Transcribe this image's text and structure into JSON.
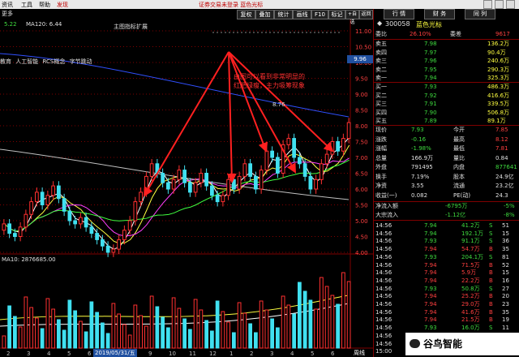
{
  "menubar": {
    "items": [
      "资讯",
      "工具",
      "帮助"
    ],
    "brand": "发现",
    "title": "证券交易未登录  蓝色光标"
  },
  "toolbar": {
    "left_items": [
      "更多"
    ],
    "ma_label": "5.22",
    "ma120": "MA120: 6.44",
    "tabs": [
      "复权",
      "叠加",
      "统计",
      "画线",
      "F10",
      "标记",
      "+自选",
      "返回"
    ]
  },
  "chart": {
    "concept_labels": [
      "教育",
      "人工智能",
      "RCS概念",
      "字节跳动"
    ],
    "price_marker": "9.96",
    "sub_indicator": "MA10: 2876685.00",
    "date_label": "2019/05/31/五",
    "main_label": "主图指标扩展",
    "y_ticks": [
      "11.00",
      "10.50",
      "10.00",
      "9.50",
      "9.00",
      "8.50",
      "8.00",
      "7.50",
      "7.00",
      "6.50",
      "6.00",
      "5.50",
      "5.00",
      "4.50",
      "4.00"
    ],
    "x_ticks": [
      "2",
      "3",
      "4",
      "5",
      "6",
      "7",
      "8",
      "9",
      "10",
      "11",
      "12",
      "1",
      "2",
      "3",
      "4",
      "5",
      "6"
    ],
    "vol_ticks": [
      "×1000"
    ],
    "annotation": "由图可以看到非常明显的\n红肥绿瘦，主力吸筹现象",
    "peak_label": "8.76",
    "bottom_label": "周线"
  },
  "right_panel": {
    "tabs": [
      "行 情",
      "财 务",
      "同 列"
    ],
    "code": "300058",
    "name": "蓝色光标",
    "weibi": {
      "label": "委比",
      "value": "26.10%",
      "label2": "委差",
      "value2": "9617"
    },
    "sell": [
      {
        "label": "卖五",
        "price": "7.98",
        "vol": "136.2万"
      },
      {
        "label": "卖四",
        "price": "7.97",
        "vol": "90.4万"
      },
      {
        "label": "卖三",
        "price": "7.96",
        "vol": "240.6万"
      },
      {
        "label": "卖二",
        "price": "7.95",
        "vol": "290.3万"
      },
      {
        "label": "卖一",
        "price": "7.94",
        "vol": "325.3万"
      }
    ],
    "buy": [
      {
        "label": "买一",
        "price": "7.93",
        "vol": "486.3万"
      },
      {
        "label": "买二",
        "price": "7.92",
        "vol": "416.6万"
      },
      {
        "label": "买三",
        "price": "7.91",
        "vol": "339.5万"
      },
      {
        "label": "买四",
        "price": "7.90",
        "vol": "506.8万"
      },
      {
        "label": "买五",
        "price": "7.89",
        "vol": "89.1万"
      }
    ],
    "stats": [
      {
        "l1": "现价",
        "v1": "7.93",
        "l2": "今开",
        "v2": "7.85"
      },
      {
        "l1": "涨跌",
        "v1": "-0.16",
        "l2": "最高",
        "v2": "8.12"
      },
      {
        "l1": "涨幅",
        "v1": "-1.98%",
        "l2": "最低",
        "v2": "7.81"
      },
      {
        "l1": "总量",
        "v1": "166.9万",
        "l2": "量比",
        "v2": "0.84"
      },
      {
        "l1": "外盘",
        "v1": "791495",
        "l2": "内盘",
        "v2": "877641"
      },
      {
        "l1": "换手",
        "v1": "7.19%",
        "l2": "股本",
        "v2": "24.9亿"
      },
      {
        "l1": "净资",
        "v1": "3.55",
        "l2": "流通",
        "v2": "23.2亿"
      },
      {
        "l1": "收益(一)",
        "v1": "0.082",
        "l2": "PE(动)",
        "v2": "24.3"
      }
    ],
    "flow": [
      {
        "label": "净流入额",
        "value": "-6795万",
        "pct": "-5%"
      },
      {
        "label": "大宗流入",
        "value": "-1.12亿",
        "pct": "-8%"
      }
    ],
    "ticks": [
      {
        "time": "14:56",
        "price": "7.94",
        "vol": "41.2万",
        "bs": "S",
        "n": "51"
      },
      {
        "time": "14:56",
        "price": "7.94",
        "vol": "192.1万",
        "bs": "S",
        "n": "15"
      },
      {
        "time": "14:56",
        "price": "7.93",
        "vol": "91.1万",
        "bs": "S",
        "n": "36"
      },
      {
        "time": "14:56",
        "price": "7.94",
        "vol": "54.7万",
        "bs": "B",
        "n": "35"
      },
      {
        "time": "14:56",
        "price": "7.93",
        "vol": "204.1万",
        "bs": "S",
        "n": "81"
      },
      {
        "time": "14:56",
        "price": "7.94",
        "vol": "71.5万",
        "bs": "B",
        "n": "52"
      },
      {
        "time": "14:56",
        "price": "7.94",
        "vol": "5.9万",
        "bs": "B",
        "n": "15"
      },
      {
        "time": "14:56",
        "price": "7.94",
        "vol": "22.2万",
        "bs": "B",
        "n": "16"
      },
      {
        "time": "14:56",
        "price": "7.93",
        "vol": "50.8万",
        "bs": "S",
        "n": "27"
      },
      {
        "time": "14:56",
        "price": "7.94",
        "vol": "25.2万",
        "bs": "B",
        "n": "20"
      },
      {
        "time": "14:56",
        "price": "7.94",
        "vol": "29.0万",
        "bs": "B",
        "n": "23"
      },
      {
        "time": "14:56",
        "price": "7.94",
        "vol": "41.6万",
        "bs": "B",
        "n": "35"
      },
      {
        "time": "14:56",
        "price": "7.94",
        "vol": "21.5万",
        "bs": "B",
        "n": "19"
      },
      {
        "time": "14:56",
        "price": "7.93",
        "vol": "16.0万",
        "bs": "S",
        "n": "11"
      },
      {
        "time": "14:56",
        "price": "7.93",
        "vol": "9.8万",
        "bs": "S",
        "n": "8"
      },
      {
        "time": "14:56",
        "price": "7.94",
        "vol": "41.6万",
        "bs": "B",
        "n": "4"
      },
      {
        "time": "15:00",
        "price": "7.93",
        "vol": "2206万",
        "bs": "S",
        "n": "780"
      }
    ]
  },
  "watermark": "谷鸟智能"
}
